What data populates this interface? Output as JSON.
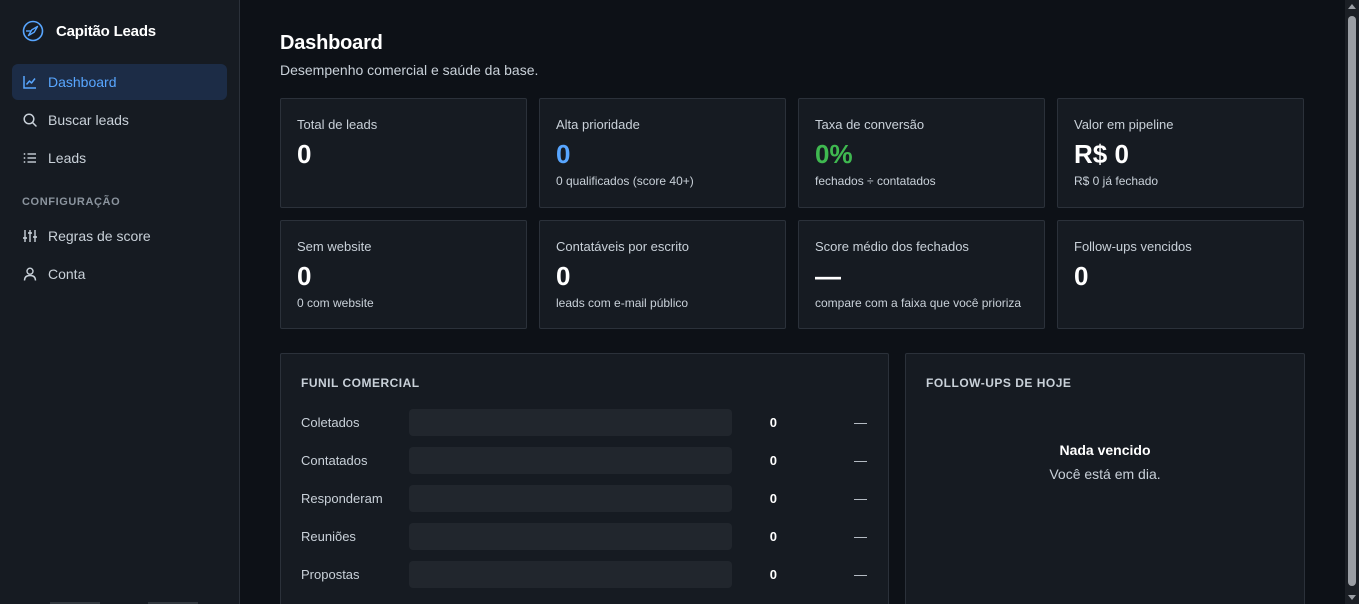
{
  "brand": {
    "name": "Capitão Leads"
  },
  "colors": {
    "accent": "#58a6ff",
    "success": "#3fb950",
    "active_bg": "#1c2c46"
  },
  "sidebar": {
    "items": [
      {
        "label": "Dashboard",
        "icon": "chart-line-icon",
        "active": true
      },
      {
        "label": "Buscar leads",
        "icon": "search-icon",
        "active": false
      },
      {
        "label": "Leads",
        "icon": "list-icon",
        "active": false
      }
    ],
    "section_label": "CONFIGURAÇÃO",
    "config_items": [
      {
        "label": "Regras de score",
        "icon": "sliders-icon"
      },
      {
        "label": "Conta",
        "icon": "user-icon"
      }
    ]
  },
  "header": {
    "title": "Dashboard",
    "subtitle": "Desempenho comercial e saúde da base."
  },
  "kpis": [
    {
      "label": "Total de leads",
      "value": "0",
      "sub": ""
    },
    {
      "label": "Alta prioridade",
      "value": "0",
      "sub": "0 qualificados (score 40+)"
    },
    {
      "label": "Taxa de conversão",
      "value": "0%",
      "sub": "fechados ÷ contatados"
    },
    {
      "label": "Valor em pipeline",
      "value": "R$ 0",
      "sub": "R$ 0 já fechado"
    },
    {
      "label": "Sem website",
      "value": "0",
      "sub": "0 com website"
    },
    {
      "label": "Contatáveis por escrito",
      "value": "0",
      "sub": "leads com e-mail público"
    },
    {
      "label": "Score médio dos fechados",
      "value": "—",
      "sub": "compare com a faixa que você prioriza"
    },
    {
      "label": "Follow-ups vencidos",
      "value": "0",
      "sub": ""
    }
  ],
  "funnel": {
    "title": "FUNIL COMERCIAL",
    "stages": [
      {
        "label": "Coletados",
        "count": "0",
        "rate": "—",
        "fill": 0
      },
      {
        "label": "Contatados",
        "count": "0",
        "rate": "—",
        "fill": 0
      },
      {
        "label": "Responderam",
        "count": "0",
        "rate": "—",
        "fill": 0
      },
      {
        "label": "Reuniões",
        "count": "0",
        "rate": "—",
        "fill": 0
      },
      {
        "label": "Propostas",
        "count": "0",
        "rate": "—",
        "fill": 0
      }
    ]
  },
  "followups": {
    "title": "FOLLOW-UPS DE HOJE",
    "empty_title": "Nada vencido",
    "empty_sub": "Você está em dia."
  }
}
